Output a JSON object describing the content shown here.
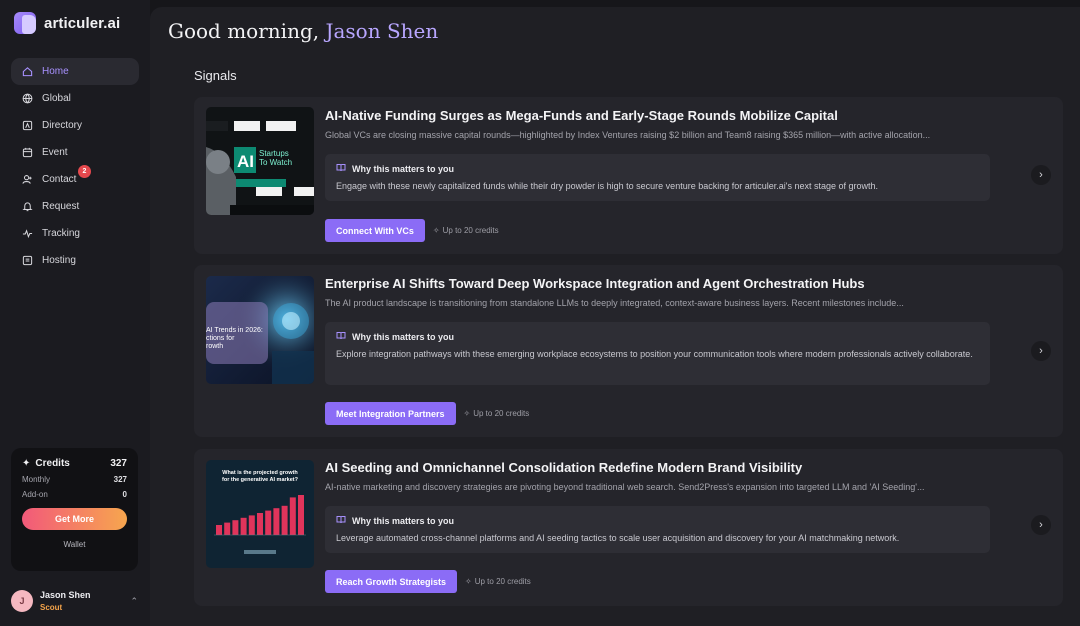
{
  "brand": {
    "name": "articuler.ai"
  },
  "nav": [
    {
      "label": "Home",
      "icon": "home-icon",
      "active": true
    },
    {
      "label": "Global",
      "icon": "globe-icon"
    },
    {
      "label": "Directory",
      "icon": "directory-icon"
    },
    {
      "label": "Event",
      "icon": "calendar-icon"
    },
    {
      "label": "Contact",
      "icon": "contact-icon",
      "badge": "2"
    },
    {
      "label": "Request",
      "icon": "bell-icon"
    },
    {
      "label": "Tracking",
      "icon": "activity-icon"
    },
    {
      "label": "Hosting",
      "icon": "hosting-icon"
    }
  ],
  "credits": {
    "title": "Credits",
    "total": "327",
    "monthly_label": "Monthly",
    "monthly": "327",
    "addon_label": "Add-on",
    "addon": "0",
    "get_more": "Get More",
    "wallet": "Wallet"
  },
  "user": {
    "initial": "J",
    "name": "Jason Shen",
    "role": "Scout"
  },
  "greeting": {
    "prefix": "Good morning, ",
    "name": "Jason Shen"
  },
  "section_title": "Signals",
  "signals": [
    {
      "title": "AI-Native Funding Surges as Mega-Funds and Early-Stage Rounds Mobilize Capital",
      "desc": "Global VCs are closing massive capital rounds—highlighted by Index Ventures raising $2 billion and Team8 raising $365 million—with active allocation...",
      "why_label": "Why this matters to you",
      "why_text": "Engage with these newly capitalized funds while their dry powder is high to secure venture backing for articuler.ai's next stage of growth.",
      "cta": "Connect With VCs",
      "cost": "Up to 20 credits",
      "thumb": {
        "line1": "Startups",
        "line2": "To Watch",
        "big": "AI"
      }
    },
    {
      "title": "Enterprise AI Shifts Toward Deep Workspace Integration and Agent Orchestration Hubs",
      "desc": "The AI product landscape is transitioning from standalone LLMs to deeply integrated, context-aware business layers. Recent milestones include...",
      "why_label": "Why this matters to you",
      "why_text": "Explore integration pathways with these emerging workplace ecosystems to position your communication tools where modern professionals actively collaborate.",
      "cta": "Meet Integration Partners",
      "cost": "Up to 20 credits",
      "thumb": {
        "line1": "AI Trends in 2026:",
        "line2": "ctions for",
        "line3": "rowth"
      }
    },
    {
      "title": "AI Seeding and Omnichannel Consolidation Redefine Modern Brand Visibility",
      "desc": "AI-native marketing and discovery strategies are pivoting beyond traditional web search. Send2Press's expansion into targeted LLM and 'AI Seeding'...",
      "why_label": "Why this matters to you",
      "why_text": "Leverage automated cross-channel platforms and AI seeding tactics to scale user acquisition and discovery for your AI matchmaking network.",
      "cta": "Reach Growth Strategists",
      "cost": "Up to 20 credits",
      "thumb": {
        "line1": "What is the projected growth",
        "line2": "for the generative AI market?"
      }
    }
  ],
  "colors": {
    "accent": "#8b6cf6",
    "greet_name": "#b8a6ff",
    "badge": "#e5484d",
    "scout": "#f5a44a"
  }
}
